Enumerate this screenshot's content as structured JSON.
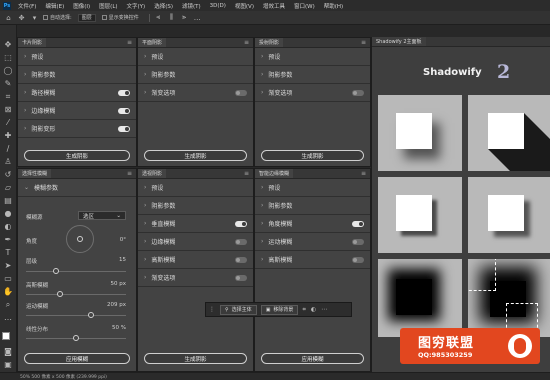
{
  "menubar": {
    "logo": "Ps",
    "items": [
      "文件(F)",
      "编辑(E)",
      "图像(I)",
      "图层(L)",
      "文字(Y)",
      "选择(S)",
      "滤镜(T)",
      "3D(D)",
      "视图(V)",
      "增效工具",
      "窗口(W)",
      "帮助(H)"
    ]
  },
  "optionsbar": {
    "auto_select_label": "自动选择:",
    "layer_select": "图层",
    "show_transform_label": "显示变换控件"
  },
  "panel_card": {
    "tab": "卡片阴影",
    "rows": [
      {
        "label": "预设",
        "toggle": null
      },
      {
        "label": "阴影参数",
        "toggle": null
      },
      {
        "label": "路径模糊",
        "toggle": true
      },
      {
        "label": "边缘模糊",
        "toggle": true
      },
      {
        "label": "阴影变形",
        "toggle": true
      }
    ],
    "button": "生成阴影"
  },
  "panel_flat": {
    "tab": "平面阴影",
    "rows": [
      {
        "label": "预设",
        "toggle": null
      },
      {
        "label": "阴影参数",
        "toggle": null
      },
      {
        "label": "渐变选项",
        "toggle": false
      }
    ],
    "button": "生成阴影"
  },
  "panel_ai": {
    "tab": "投射阴影",
    "rows": [
      {
        "label": "预设",
        "toggle": null
      },
      {
        "label": "阴影参数",
        "toggle": null
      },
      {
        "label": "渐变选项",
        "toggle": false
      }
    ],
    "button": "生成阴影"
  },
  "panel_selection": {
    "tab": "选择性模糊",
    "section": "模糊参数",
    "mode_label": "模糊源",
    "mode_value": "选区",
    "params": [
      {
        "label": "角度",
        "value": "0°",
        "level": 0
      },
      {
        "label": "层级",
        "value": "15",
        "level": 0.15
      },
      {
        "label": "高斯模糊",
        "value": "50 px",
        "level": 0.25
      },
      {
        "label": "运动模糊",
        "value": "209 px",
        "level": 0.65
      },
      {
        "label": "线性分布",
        "value": "50 %",
        "level": 0.5
      }
    ],
    "button": "应用模糊"
  },
  "panel_transparent": {
    "tab": "透视阴影",
    "rows": [
      {
        "label": "预设",
        "toggle": null
      },
      {
        "label": "阴影参数",
        "toggle": null
      },
      {
        "label": "垂直模糊",
        "toggle": true
      },
      {
        "label": "边缘模糊",
        "toggle": false
      },
      {
        "label": "高斯模糊",
        "toggle": false
      },
      {
        "label": "渐变选项",
        "toggle": false
      }
    ],
    "button": "生成阴影"
  },
  "panel_smart": {
    "tab": "智能边缘模糊",
    "rows": [
      {
        "label": "预设",
        "toggle": null
      },
      {
        "label": "阴影参数",
        "toggle": null
      },
      {
        "label": "角度模糊",
        "toggle": true
      },
      {
        "label": "运动模糊",
        "toggle": false
      },
      {
        "label": "高斯模糊",
        "toggle": false
      }
    ],
    "button": "应用模糊"
  },
  "floatbar": {
    "select_subject": "选择主体",
    "remove_bg": "移除背景"
  },
  "shadowify": {
    "tab": "Shadowify 2主面板",
    "logo_text": "Shadowify",
    "logo_num": "2"
  },
  "watermark": {
    "title": "图穷联盟",
    "sub": "QQ:985303259"
  },
  "statusbar": {
    "text": "50%    500 像素 x 500 像素 (239.999 ppi)"
  }
}
